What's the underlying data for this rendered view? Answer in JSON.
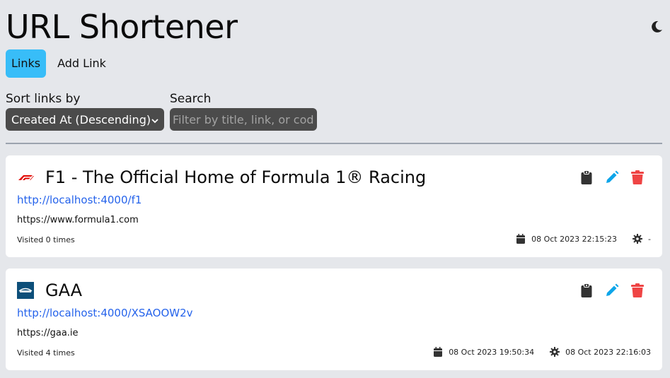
{
  "app": {
    "title": "URL Shortener",
    "theme_icon": "moon-icon"
  },
  "tabs": [
    {
      "label": "Links",
      "active": true
    },
    {
      "label": "Add Link",
      "active": false
    }
  ],
  "filters": {
    "sort_label": "Sort links by",
    "sort_value": "Created At (Descending)",
    "search_label": "Search",
    "search_placeholder": "Filter by title, link, or code",
    "search_value": ""
  },
  "links": [
    {
      "title": "F1 - The Official Home of Formula 1® Racing",
      "favicon": "f1-logo",
      "short_url": "http://localhost:4000/f1",
      "destination": "https://www.formula1.com",
      "visits": "Visited 0 times",
      "created": "08 Oct 2023 22:15:23",
      "updated": "-"
    },
    {
      "title": "GAA",
      "favicon": "gaa-logo",
      "short_url": "http://localhost:4000/XSAOOW2v",
      "destination": "https://gaa.ie",
      "visits": "Visited 4 times",
      "created": "08 Oct 2023 19:50:34",
      "updated": "08 Oct 2023 22:16:03"
    }
  ],
  "colors": {
    "background": "#e5e7eb",
    "active_tab": "#38bdf8",
    "link": "#2563eb",
    "edit_icon": "#0ea5e9",
    "delete_icon": "#ef4444",
    "input_bg": "#4b4b4b"
  }
}
